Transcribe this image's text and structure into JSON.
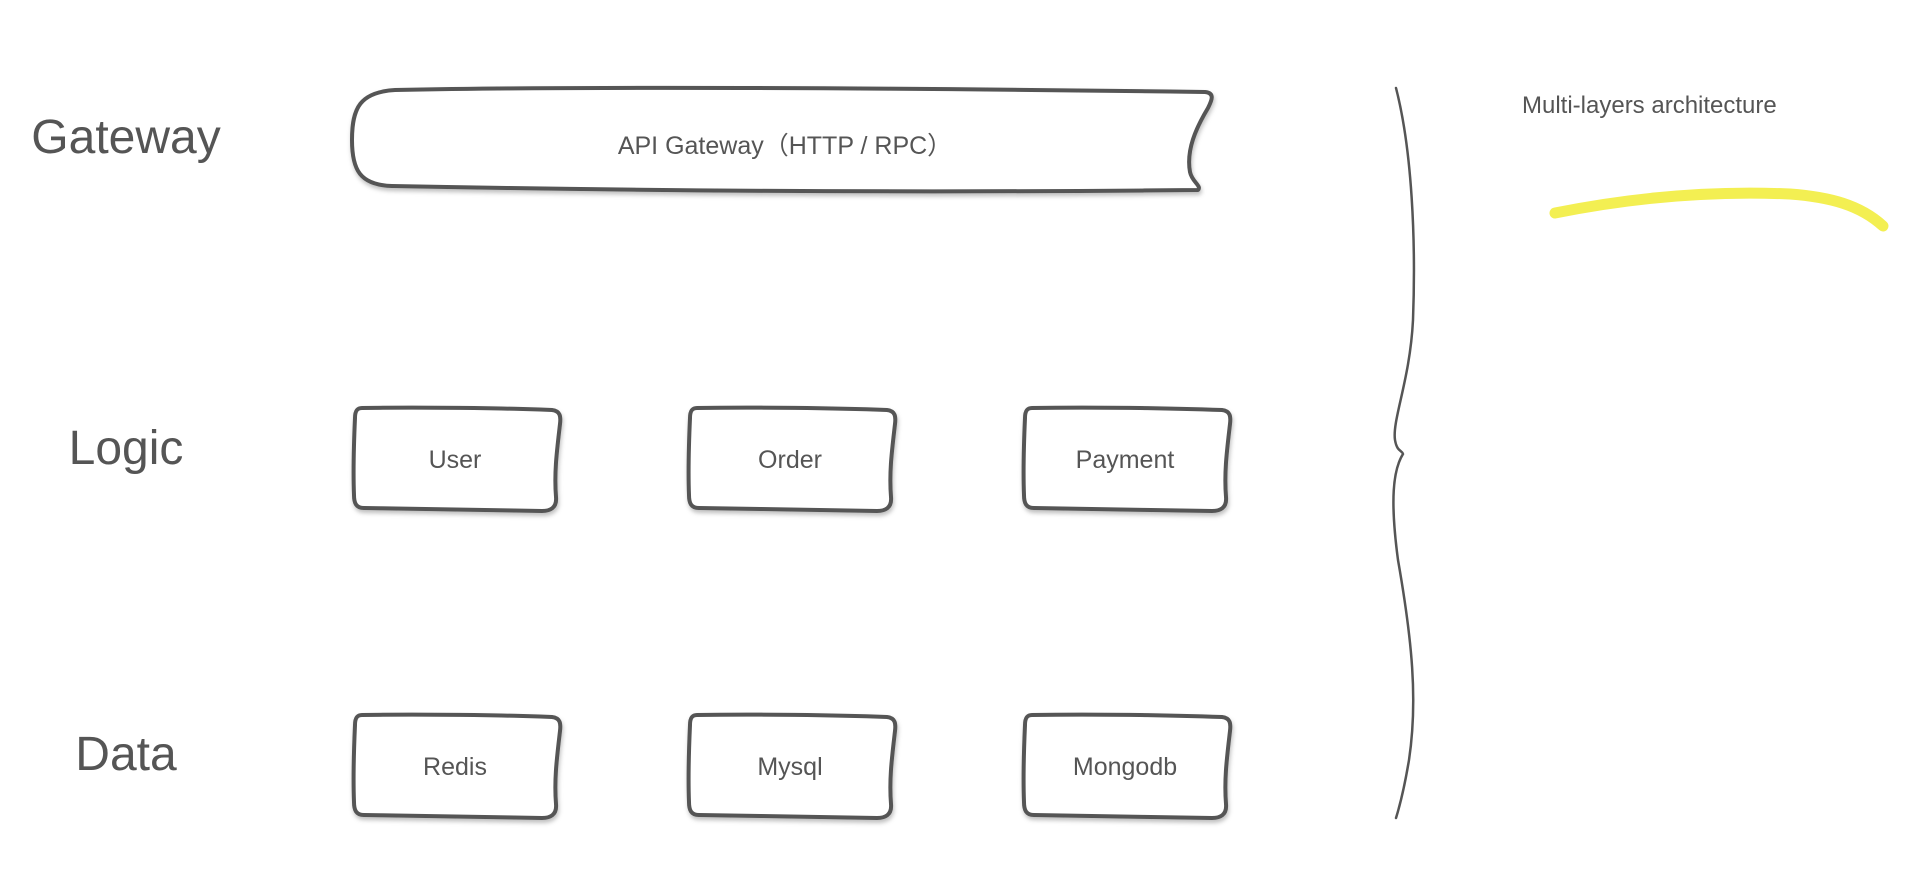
{
  "layers": {
    "gateway": "Gateway",
    "logic": "Logic",
    "data": "Data"
  },
  "gateway_box": {
    "label": "API Gateway（HTTP / RPC）"
  },
  "logic_boxes": {
    "user": "User",
    "order": "Order",
    "payment": "Payment"
  },
  "data_boxes": {
    "redis": "Redis",
    "mysql": "Mysql",
    "mongodb": "Mongodb"
  },
  "note": {
    "text": "Multi-layers architecture",
    "highlight_color": "#f3ef52"
  },
  "colors": {
    "stroke": "#555555",
    "text": "#555555"
  }
}
